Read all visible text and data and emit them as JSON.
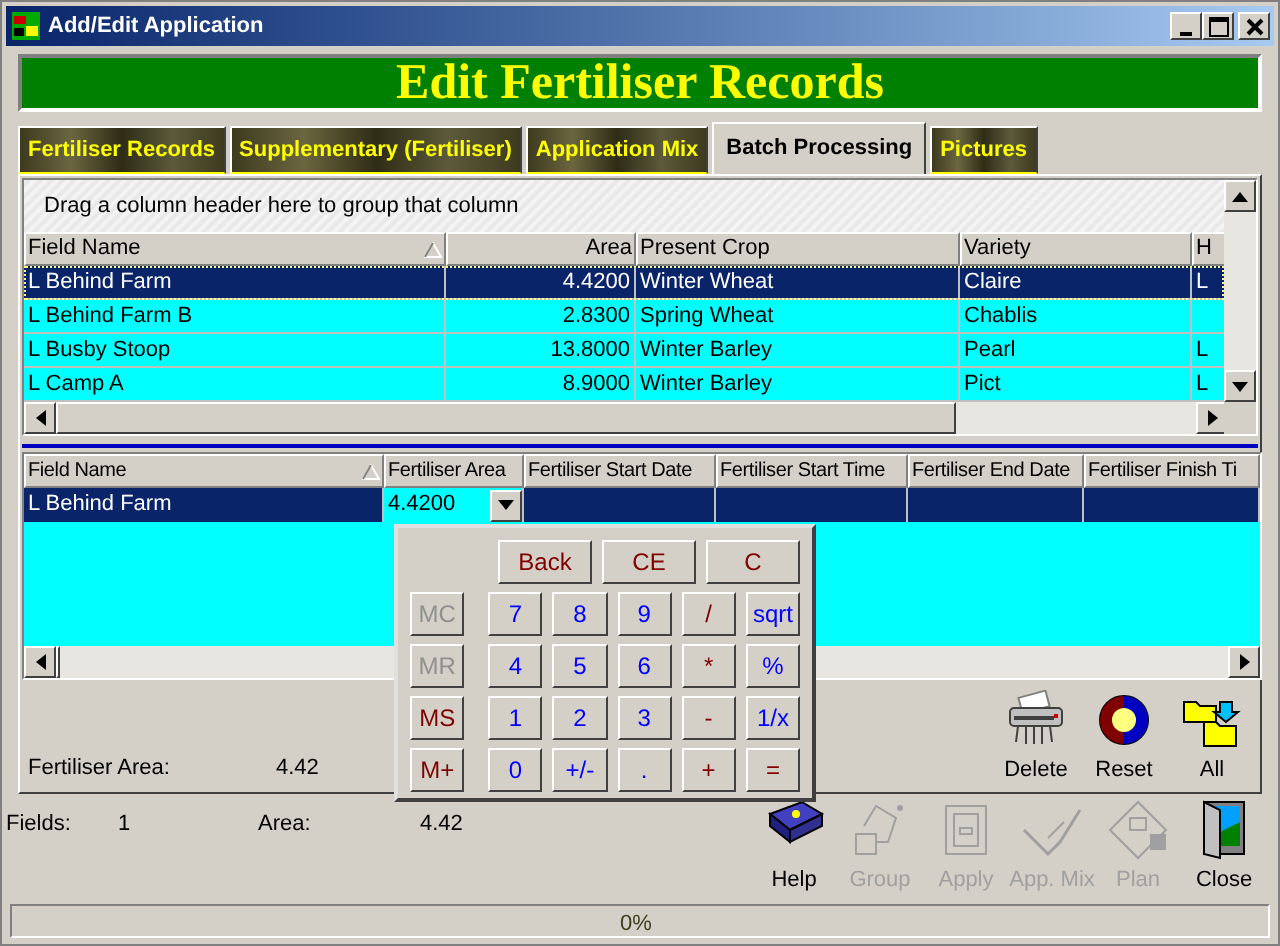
{
  "window": {
    "title": "Add/Edit Application"
  },
  "banner": "Edit Fertiliser Records",
  "tabs": [
    {
      "label": "Fertiliser Records",
      "selected": false
    },
    {
      "label": "Supplementary (Fertiliser)",
      "selected": false
    },
    {
      "label": "Application Mix",
      "selected": false
    },
    {
      "label": "Batch Processing",
      "selected": true
    },
    {
      "label": "Pictures",
      "selected": false
    }
  ],
  "group_hint": "Drag a column header here to group that column",
  "fields_grid": {
    "columns": [
      {
        "label": "Field Name",
        "sorted": true
      },
      {
        "label": "Area",
        "sorted": false
      },
      {
        "label": "Present Crop",
        "sorted": false
      },
      {
        "label": "Variety",
        "sorted": false
      },
      {
        "label": "H",
        "sorted": false
      }
    ],
    "rows": [
      {
        "cells": [
          "L Behind Farm",
          "4.4200",
          "Winter Wheat",
          "Claire",
          "L"
        ],
        "selected": true
      },
      {
        "cells": [
          "L Behind Farm B",
          "2.8300",
          "Spring Wheat",
          "Chablis"
        ],
        "selected": false
      },
      {
        "cells": [
          "L Busby Stoop",
          "13.8000",
          "Winter Barley",
          "Pearl",
          "L"
        ],
        "selected": false
      },
      {
        "cells": [
          "L Camp A",
          "8.9000",
          "Winter Barley",
          "Pict",
          "L"
        ],
        "selected": false
      }
    ]
  },
  "batch_grid": {
    "columns": [
      {
        "label": "Field Name",
        "sorted": true
      },
      {
        "label": "Fertiliser Area",
        "sorted": false
      },
      {
        "label": "Fertiliser Start Date",
        "sorted": false
      },
      {
        "label": "Fertiliser Start Time",
        "sorted": false
      },
      {
        "label": "Fertiliser End Date",
        "sorted": false
      },
      {
        "label": "Fertiliser Finish Ti",
        "sorted": false
      }
    ],
    "rows": [
      {
        "cells": [
          {
            "text": "L Behind Farm",
            "editing": false
          },
          {
            "text": "4.4200",
            "editing": true
          }
        ],
        "selected": true
      }
    ]
  },
  "calculator": {
    "top_keys": [
      "Back",
      "CE",
      "C"
    ],
    "rows": [
      {
        "memory": {
          "label": "MC",
          "disabled": true
        },
        "keys": [
          {
            "label": "7",
            "kind": "number"
          },
          {
            "label": "8",
            "kind": "number"
          },
          {
            "label": "9",
            "kind": "number"
          },
          {
            "label": "/",
            "kind": "operator"
          },
          {
            "label": "sqrt",
            "kind": "number"
          }
        ]
      },
      {
        "memory": {
          "label": "MR",
          "disabled": true
        },
        "keys": [
          {
            "label": "4",
            "kind": "number"
          },
          {
            "label": "5",
            "kind": "number"
          },
          {
            "label": "6",
            "kind": "number"
          },
          {
            "label": "*",
            "kind": "operator"
          },
          {
            "label": "%",
            "kind": "number"
          }
        ]
      },
      {
        "memory": {
          "label": "MS",
          "disabled": false
        },
        "keys": [
          {
            "label": "1",
            "kind": "number"
          },
          {
            "label": "2",
            "kind": "number"
          },
          {
            "label": "3",
            "kind": "number"
          },
          {
            "label": "-",
            "kind": "operator"
          },
          {
            "label": "1/x",
            "kind": "number"
          }
        ]
      },
      {
        "memory": {
          "label": "M+",
          "disabled": false
        },
        "keys": [
          {
            "label": "0",
            "kind": "number"
          },
          {
            "label": "+/-",
            "kind": "number"
          },
          {
            "label": ".",
            "kind": "number"
          },
          {
            "label": "+",
            "kind": "operator"
          },
          {
            "label": "=",
            "kind": "operator"
          }
        ]
      }
    ]
  },
  "summary": {
    "label": "Fertiliser Area:",
    "value": "4.42"
  },
  "actions": [
    {
      "label": "Delete",
      "kind": "shredder"
    },
    {
      "label": "Reset",
      "kind": "reset"
    },
    {
      "label": "All",
      "kind": "folders"
    }
  ],
  "totals": {
    "fields_label": "Fields:",
    "fields": "1",
    "area_label": "Area:",
    "area": "4.42"
  },
  "toolbar": [
    {
      "label": "Help",
      "kind": "help",
      "disabled": false
    },
    {
      "label": "Group",
      "kind": "group",
      "disabled": true
    },
    {
      "label": "Apply",
      "kind": "apply",
      "disabled": true
    },
    {
      "label": "App. Mix",
      "kind": "mix",
      "disabled": true
    },
    {
      "label": "Plan",
      "kind": "plan",
      "disabled": true
    },
    {
      "label": "Close",
      "kind": "close",
      "disabled": false
    }
  ],
  "progress": {
    "level": 0,
    "text": "0%"
  }
}
